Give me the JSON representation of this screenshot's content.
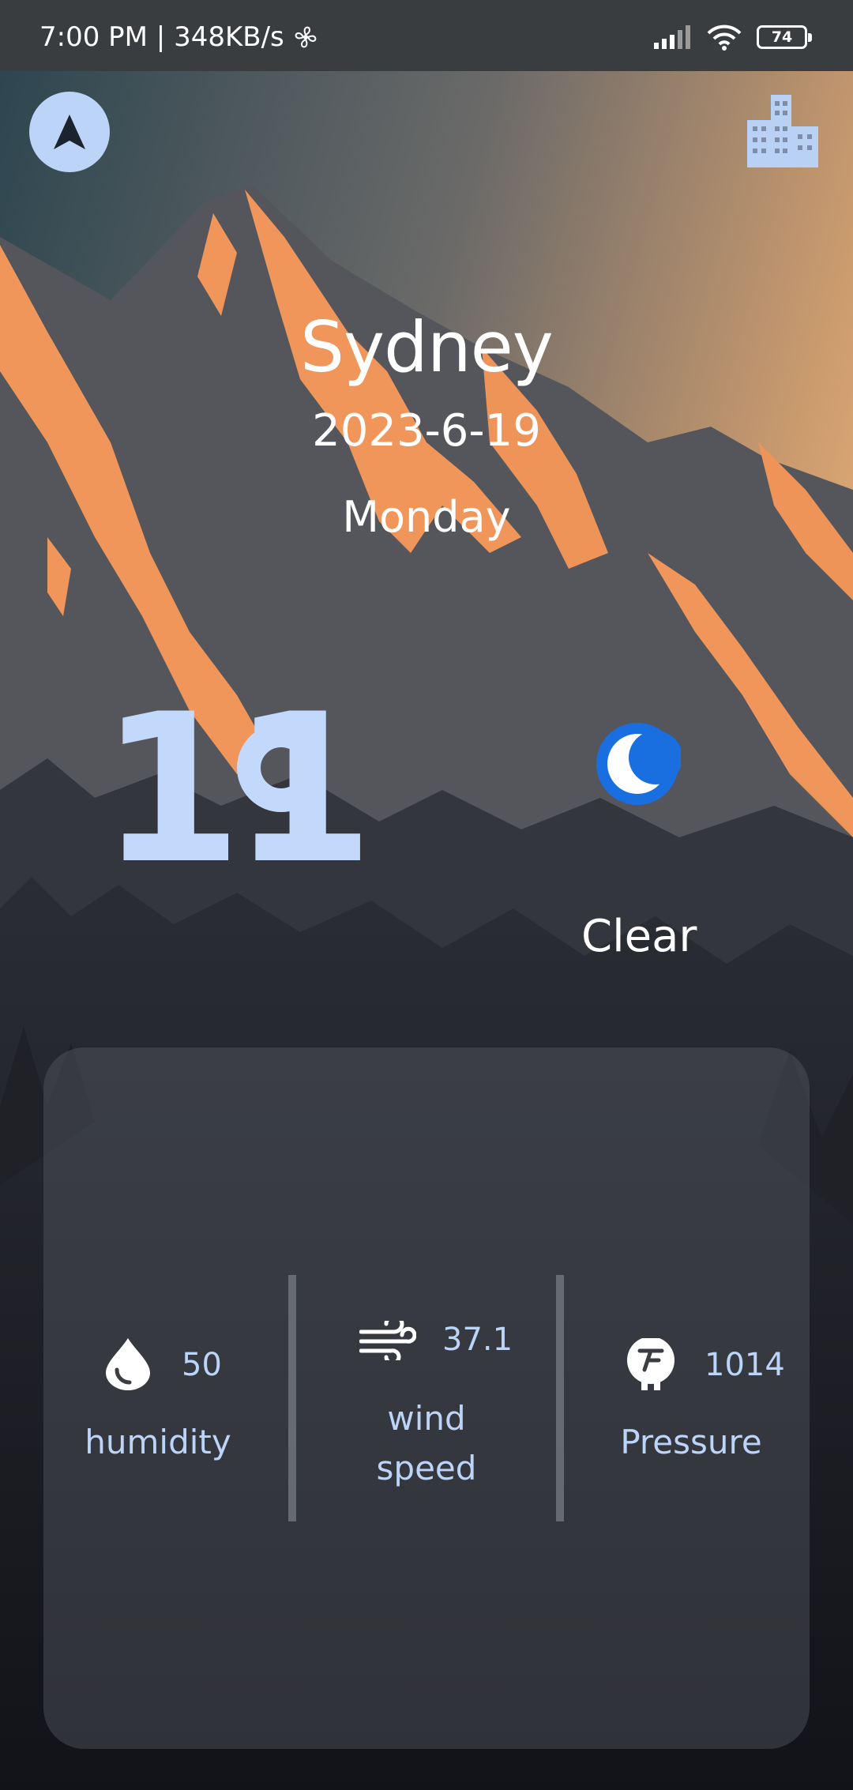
{
  "status_bar": {
    "time_speed": "7:00 PM | 348KB/s",
    "battery": "74"
  },
  "location": {
    "city": "Sydney",
    "date": "2023-6-19",
    "weekday": "Monday"
  },
  "current": {
    "temperature": "11",
    "condition": "Clear"
  },
  "metrics": {
    "humidity": {
      "value": "50",
      "label": "humidity"
    },
    "wind": {
      "value": "37.1",
      "label_line1": "wind",
      "label_line2": "speed"
    },
    "pressure": {
      "value": "1014",
      "label": "Pressure"
    }
  },
  "colors": {
    "accent": "#bcd4f7",
    "moon_blue": "#1a6fe0",
    "peak_orange": "#f0965a"
  },
  "icons": {
    "navigation": "navigation-arrow-icon",
    "city": "city-building-icon",
    "weather": "moon-icon",
    "humidity": "water-drop-icon",
    "wind": "wind-icon",
    "pressure": "pressure-icon"
  }
}
